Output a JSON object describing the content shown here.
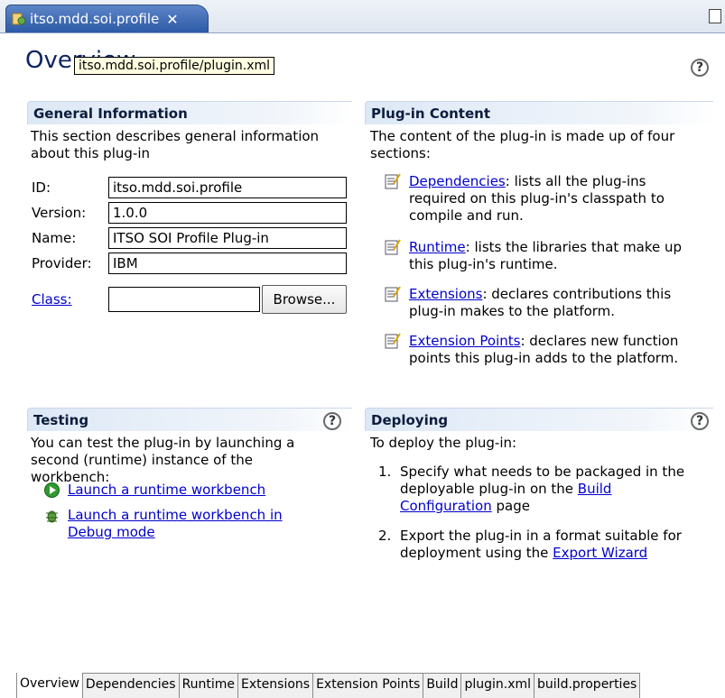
{
  "editor": {
    "tab_title": "itso.mdd.soi.profile",
    "close_glyph": "✕",
    "form_title": "Overview",
    "tooltip": "itso.mdd.soi.profile/plugin.xml"
  },
  "general": {
    "heading": "General Information",
    "description": "This section describes general information about this plug-in",
    "fields": [
      {
        "label": "ID:",
        "value": "itso.mdd.soi.profile"
      },
      {
        "label": "Version:",
        "value": "1.0.0"
      },
      {
        "label": "Name:",
        "value": "ITSO SOI Profile Plug-in"
      },
      {
        "label": "Provider:",
        "value": "IBM"
      }
    ],
    "class_label": "Class:",
    "class_value": "",
    "browse_label": "Browse..."
  },
  "content": {
    "heading": "Plug-in Content",
    "description": "The content of the plug-in is made up of four sections:",
    "items": [
      {
        "link": "Dependencies",
        "text": ": lists all the plug-ins required on this plug-in's classpath to compile and run."
      },
      {
        "link": "Runtime",
        "text": ": lists the libraries that make up this plug-in's runtime."
      },
      {
        "link": "Extensions",
        "text": ": declares contributions this plug-in makes to the platform."
      },
      {
        "link": "Extension Points",
        "text": ": declares new function points this plug-in adds to the platform."
      }
    ]
  },
  "testing": {
    "heading": "Testing",
    "description": "You can test the plug-in by launching a second (runtime) instance of the workbench:",
    "launch_run": "Launch a runtime workbench",
    "launch_debug": "Launch a runtime workbench in Debug mode"
  },
  "deploying": {
    "heading": "Deploying",
    "description": "To deploy the plug-in:",
    "step1_num": "1.",
    "step1_text": "Specify what needs to be packaged in the deployable plug-in on the ",
    "step1_link": "Build Configuration",
    "step1_tail": " page",
    "step2_num": "2.",
    "step2_text": "Export the plug-in in a format suitable for deployment using the ",
    "step2_link": "Export Wizard"
  },
  "bottom_tabs": [
    "Overview",
    "Dependencies",
    "Runtime",
    "Extensions",
    "Extension Points",
    "Build",
    "plugin.xml",
    "build.properties"
  ],
  "help_glyph": "?",
  "colors": {
    "link": "#0000cc",
    "title": "#0c2460",
    "tab_active": "#2d5aa7",
    "tooltip_bg": "#ffffe1"
  }
}
